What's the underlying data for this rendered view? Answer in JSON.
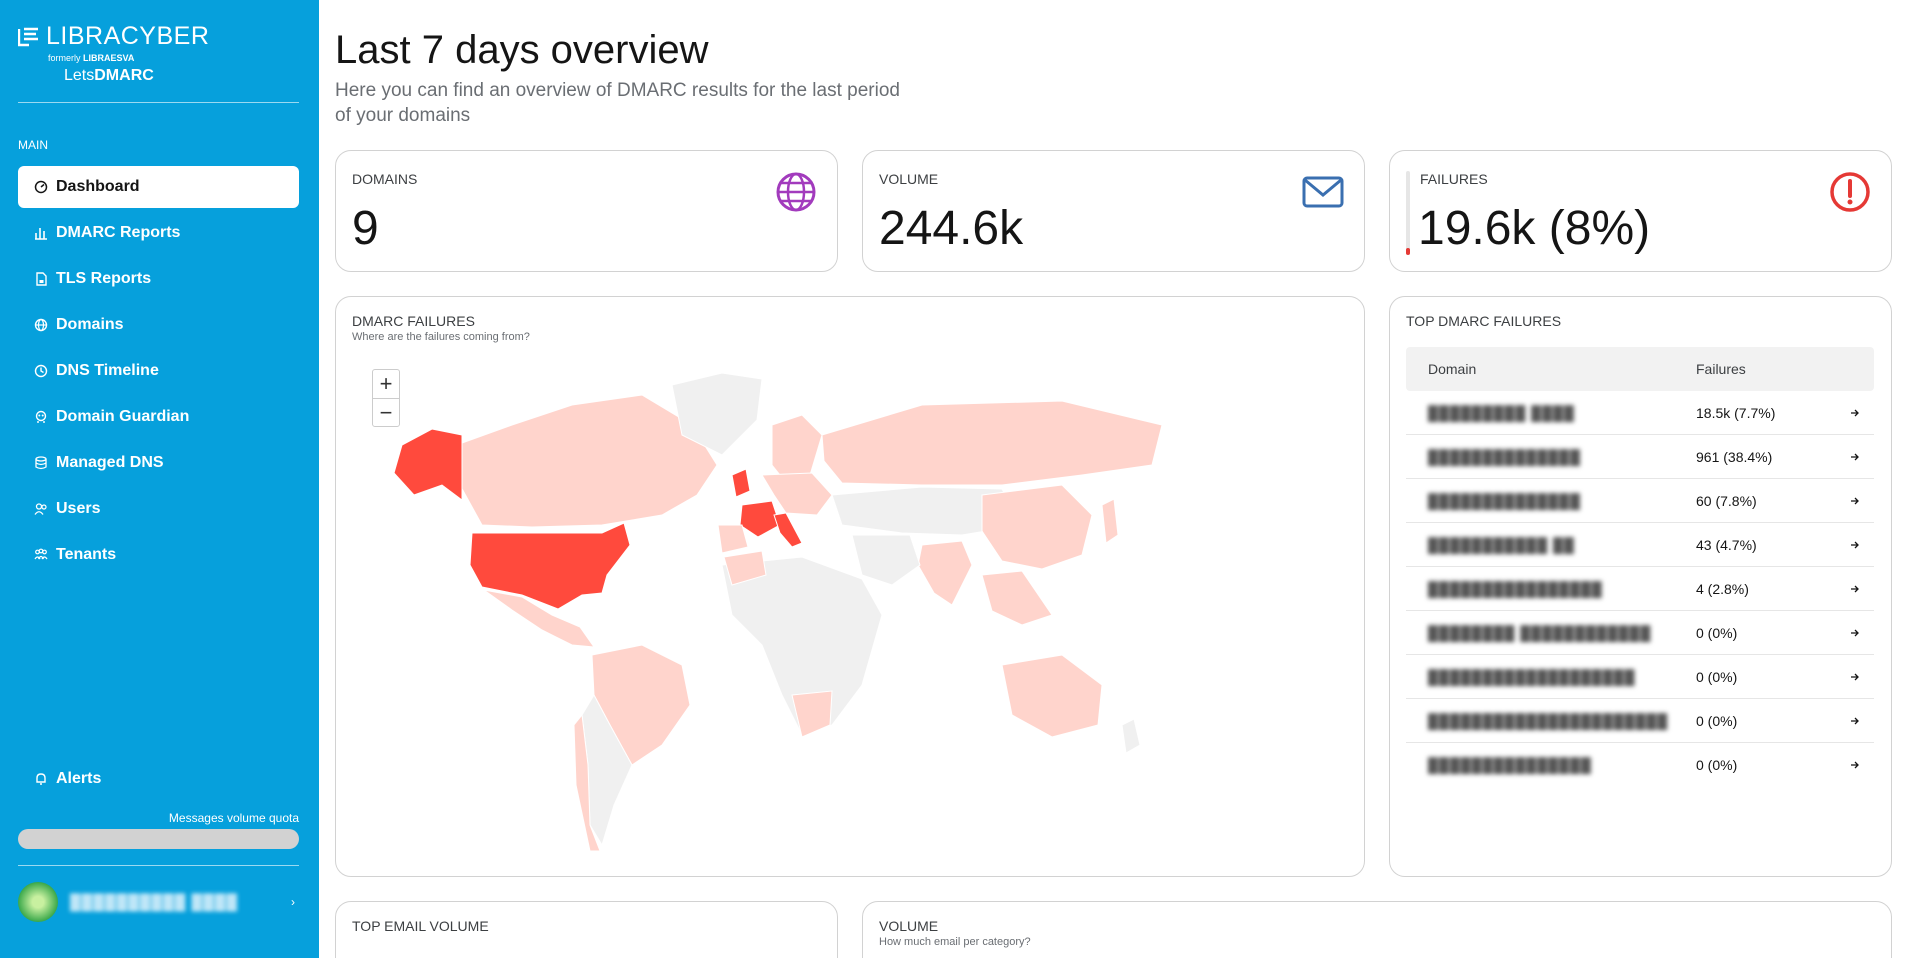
{
  "brand": {
    "name": "LIBRACYBER",
    "formerly_prefix": "formerly",
    "formerly_name": "LIBRAESVA",
    "product_prefix": "Lets",
    "product_name": "DMARC"
  },
  "sidebar": {
    "section_label": "MAIN",
    "items": [
      {
        "label": "Dashboard",
        "icon": "gauge-icon",
        "active": true
      },
      {
        "label": "DMARC Reports",
        "icon": "chart-bar-icon",
        "active": false
      },
      {
        "label": "TLS Reports",
        "icon": "document-lock-icon",
        "active": false
      },
      {
        "label": "Domains",
        "icon": "globe-icon",
        "active": false
      },
      {
        "label": "DNS Timeline",
        "icon": "clock-icon",
        "active": false
      },
      {
        "label": "Domain Guardian",
        "icon": "guardian-icon",
        "active": false
      },
      {
        "label": "Managed DNS",
        "icon": "database-icon",
        "active": false
      },
      {
        "label": "Users",
        "icon": "users-icon",
        "active": false
      },
      {
        "label": "Tenants",
        "icon": "tenants-icon",
        "active": false
      }
    ],
    "alerts_label": "Alerts",
    "quota_label": "Messages volume quota",
    "user_name": "██████████ ████"
  },
  "header": {
    "title": "Last 7 days overview",
    "subtitle": "Here you can find an overview of DMARC results for the last period of your domains"
  },
  "stats": {
    "domains": {
      "label": "DOMAINS",
      "value": "9",
      "icon": "globe-icon",
      "color": "#a23bbd"
    },
    "volume": {
      "label": "VOLUME",
      "value": "244.6k",
      "icon": "envelope-icon",
      "color": "#3a6fb0"
    },
    "failures": {
      "label": "FAILURES",
      "value": "19.6k (8%)",
      "icon": "alert-circle-icon",
      "color": "#e53935",
      "fraction": 0.08
    }
  },
  "map_card": {
    "title": "DMARC FAILURES",
    "subtitle": "Where are the failures coming from?",
    "zoom_in": "+",
    "zoom_out": "−",
    "colors": {
      "high": "#ff4a3d",
      "low": "#ffd4cc",
      "none": "#f0f0f0"
    }
  },
  "top_failures": {
    "title": "TOP DMARC FAILURES",
    "col_domain": "Domain",
    "col_failures": "Failures",
    "rows": [
      {
        "domain": "█████████ ████",
        "failures": "18.5k (7.7%)"
      },
      {
        "domain": "██████████████",
        "failures": "961 (38.4%)"
      },
      {
        "domain": "██████████████",
        "failures": "60 (7.8%)"
      },
      {
        "domain": "███████████ ██",
        "failures": "43 (4.7%)"
      },
      {
        "domain": "████████████████",
        "failures": "4 (2.8%)"
      },
      {
        "domain": "████████ ████████████",
        "failures": "0 (0%)"
      },
      {
        "domain": "███████████████████",
        "failures": "0 (0%)"
      },
      {
        "domain": "██████████████████████",
        "failures": "0 (0%)"
      },
      {
        "domain": "███████████████",
        "failures": "0 (0%)"
      }
    ]
  },
  "bottom_cards": {
    "email_volume_title": "TOP EMAIL VOLUME",
    "volume_title": "VOLUME",
    "volume_subtitle": "How much email per category?"
  }
}
